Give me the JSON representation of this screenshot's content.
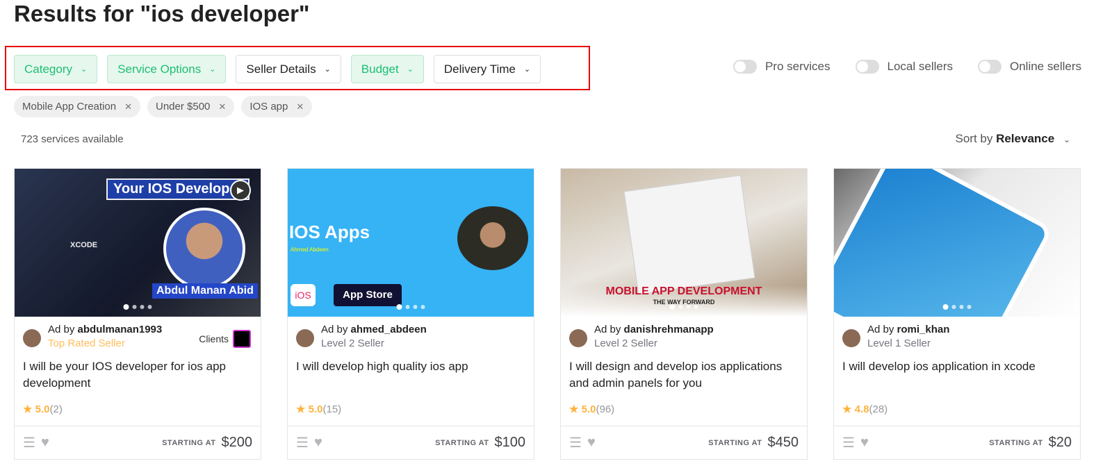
{
  "page_title": "Results for \"ios developer\"",
  "filters": [
    {
      "label": "Category",
      "active": true
    },
    {
      "label": "Service Options",
      "active": true
    },
    {
      "label": "Seller Details",
      "active": false
    },
    {
      "label": "Budget",
      "active": true
    },
    {
      "label": "Delivery Time",
      "active": false
    }
  ],
  "toggles": [
    {
      "label": "Pro services",
      "on": false
    },
    {
      "label": "Local sellers",
      "on": false
    },
    {
      "label": "Online sellers",
      "on": false
    }
  ],
  "chips": [
    "Mobile App Creation",
    "Under $500",
    "IOS app"
  ],
  "count": "723 services available",
  "sort": {
    "prefix": "Sort by",
    "value": "Relevance"
  },
  "starting_at": "STARTING AT",
  "accent": "#1dbf73",
  "cards": [
    {
      "ad_prefix": "Ad by",
      "seller": "abdulmanan1993",
      "level": "Top Rated Seller",
      "clients": "Clients",
      "title": "I will be your IOS developer for ios app development",
      "rating": "5.0",
      "reviews": "(2)",
      "price": "$200",
      "image_text": [
        "Your IOS Developer",
        "Abdul Manan Abid",
        "XCODE"
      ]
    },
    {
      "ad_prefix": "Ad by",
      "seller": "ahmed_abdeen",
      "level": "Level 2 Seller",
      "title": "I will develop high quality ios app",
      "rating": "5.0",
      "reviews": "(15)",
      "price": "$100",
      "image_text": [
        "IOS Apps",
        "Ahmed Abdeen",
        "App Store",
        "iOS"
      ]
    },
    {
      "ad_prefix": "Ad by",
      "seller": "danishrehmanapp",
      "level": "Level 2 Seller",
      "title": "I will design and develop ios applications and admin panels for you",
      "rating": "5.0",
      "reviews": "(96)",
      "price": "$450",
      "image_text": [
        "MOBILE APP DEVELOPMENT",
        "THE WAY FORWARD"
      ]
    },
    {
      "ad_prefix": "Ad by",
      "seller": "romi_khan",
      "level": "Level 1 Seller",
      "title": "I will develop ios application in xcode",
      "rating": "4.8",
      "reviews": "(28)",
      "price": "$20",
      "image_text": []
    }
  ]
}
